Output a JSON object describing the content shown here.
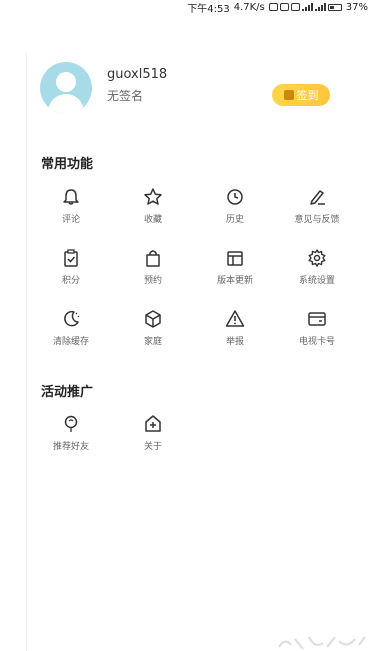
{
  "status_bar": {
    "time": "下午4:53",
    "speed": "4.7K/s",
    "battery": "37%"
  },
  "profile": {
    "username": "guoxl518",
    "signature": "无签名",
    "checkin_label": "签到"
  },
  "sections": {
    "common": {
      "title": "常用功能",
      "items": [
        {
          "label": "评论",
          "icon": "bell-icon"
        },
        {
          "label": "收藏",
          "icon": "star-icon"
        },
        {
          "label": "历史",
          "icon": "clock-icon"
        },
        {
          "label": "意见与反馈",
          "icon": "feedback-pen-icon"
        },
        {
          "label": "积分",
          "icon": "clipboard-check-icon"
        },
        {
          "label": "预约",
          "icon": "shopping-bag-icon"
        },
        {
          "label": "版本更新",
          "icon": "window-update-icon"
        },
        {
          "label": "系统设置",
          "icon": "gear-icon"
        },
        {
          "label": "清除缓存",
          "icon": "moon-icon"
        },
        {
          "label": "家庭",
          "icon": "cube-icon"
        },
        {
          "label": "举报",
          "icon": "warning-triangle-icon"
        },
        {
          "label": "电视卡号",
          "icon": "card-icon"
        }
      ]
    },
    "promo": {
      "title": "活动推广",
      "items": [
        {
          "label": "推荐好友",
          "icon": "balloon-icon"
        },
        {
          "label": "关于",
          "icon": "plus-house-icon"
        }
      ]
    }
  },
  "colors": {
    "avatar_bg": "#a8dbe8",
    "checkin_yellow": "#ffc53a"
  }
}
